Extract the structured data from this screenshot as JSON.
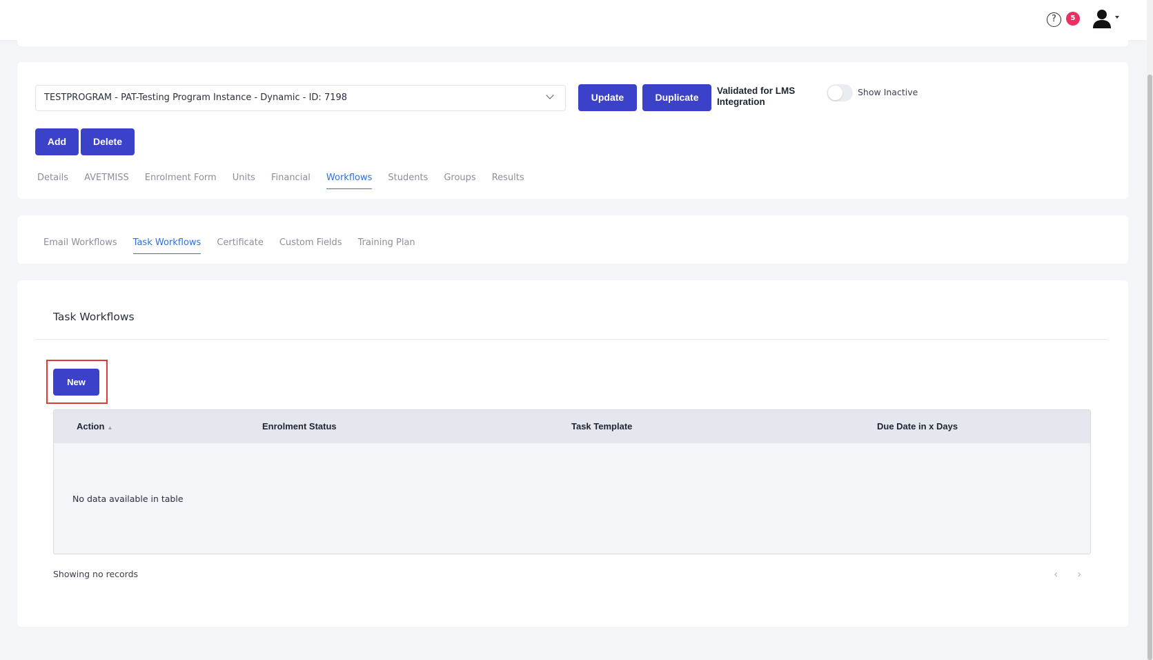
{
  "header": {
    "help_symbol": "?",
    "notification_count": "5"
  },
  "program": {
    "selected": "TESTPROGRAM - PAT-Testing Program Instance - Dynamic - ID: 7198",
    "update_label": "Update",
    "duplicate_label": "Duplicate",
    "validated_label": "Validated for LMS Integration",
    "show_inactive_label": "Show Inactive",
    "show_inactive_on": false,
    "add_label": "Add",
    "delete_label": "Delete"
  },
  "main_tabs": [
    {
      "label": "Details",
      "active": false
    },
    {
      "label": "AVETMISS",
      "active": false
    },
    {
      "label": "Enrolment Form",
      "active": false
    },
    {
      "label": "Units",
      "active": false
    },
    {
      "label": "Financial",
      "active": false
    },
    {
      "label": "Workflows",
      "active": true
    },
    {
      "label": "Students",
      "active": false
    },
    {
      "label": "Groups",
      "active": false
    },
    {
      "label": "Results",
      "active": false
    }
  ],
  "sub_tabs": [
    {
      "label": "Email Workflows",
      "active": false
    },
    {
      "label": "Task Workflows",
      "active": true
    },
    {
      "label": "Certificate",
      "active": false
    },
    {
      "label": "Custom Fields",
      "active": false
    },
    {
      "label": "Training Plan",
      "active": false
    }
  ],
  "task_workflows": {
    "title": "Task Workflows",
    "new_label": "New",
    "columns": [
      "Action",
      "Enrolment Status",
      "Task Template",
      "Due Date in x Days"
    ],
    "empty_message": "No data available in table",
    "showing_text": "Showing no records",
    "pager_prev": "‹",
    "pager_next": "›"
  },
  "colors": {
    "primary_button": "#3c41c9",
    "active_tab": "#2f6fe0",
    "badge": "#ea2f62",
    "highlight": "#e0392f"
  }
}
